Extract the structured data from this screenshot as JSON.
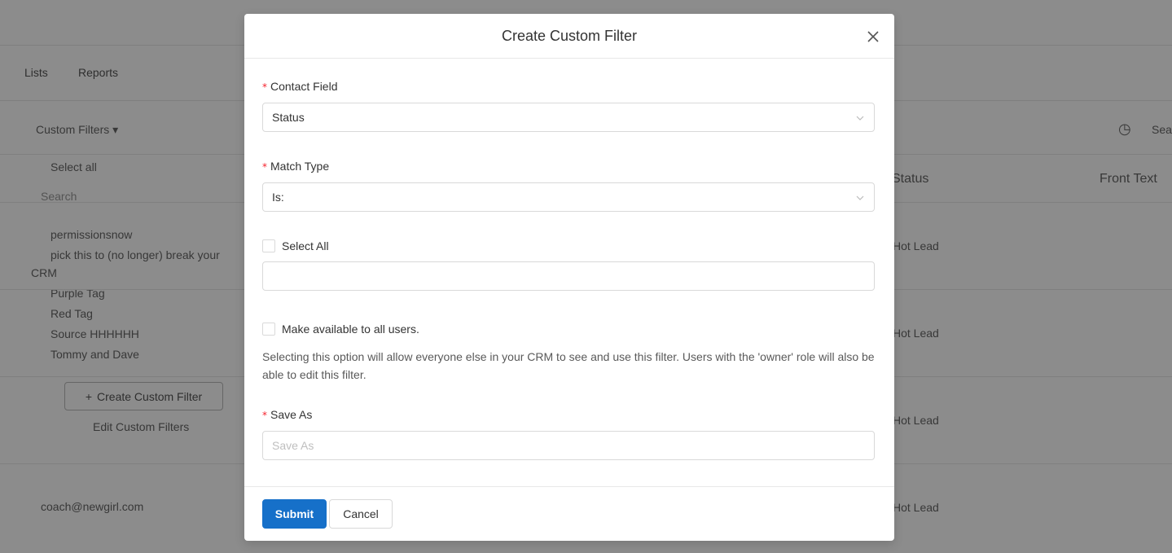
{
  "background": {
    "nav": [
      "Lists",
      "Reports"
    ],
    "toolbar_filter": "Custom Filters",
    "select_all": "Select all",
    "search_placeholder": "Search",
    "filters": [
      "permissionsnow",
      "pick this to (no longer) break your",
      "CRM",
      "Purple Tag",
      "Red Tag",
      "Source HHHHHH",
      "Tommy and Dave"
    ],
    "create_button": "Create Custom Filter",
    "edit_link": "Edit Custom Filters",
    "email": "coach@newgirl.com",
    "col_status": "Status",
    "col_front": "Front Text",
    "search_label": "Sea",
    "row_status": [
      "Hot Lead",
      "Hot Lead",
      "Hot Lead",
      "Hot Lead"
    ]
  },
  "modal": {
    "title": "Create Custom Filter",
    "contact_field": {
      "label": "Contact Field",
      "value": "Status"
    },
    "match_type": {
      "label": "Match Type",
      "value": "Is:"
    },
    "select_all": "Select All",
    "values_input": {
      "value": ""
    },
    "make_available": "Make available to all users.",
    "help_text": "Selecting this option will allow everyone else in your CRM to see and use this filter. Users with the 'owner' role will also be able to edit this filter.",
    "save_as": {
      "label": "Save As",
      "placeholder": "Save As"
    },
    "submit_label": "Submit",
    "cancel_label": "Cancel",
    "required_mark": "*"
  },
  "colors": {
    "primary": "#1670c9",
    "required": "#f5222d",
    "overlay": "rgba(0,0,0,0.45)"
  },
  "icons": [
    "close-icon",
    "chevron-down-icon",
    "plus-icon",
    "history-icon"
  ]
}
